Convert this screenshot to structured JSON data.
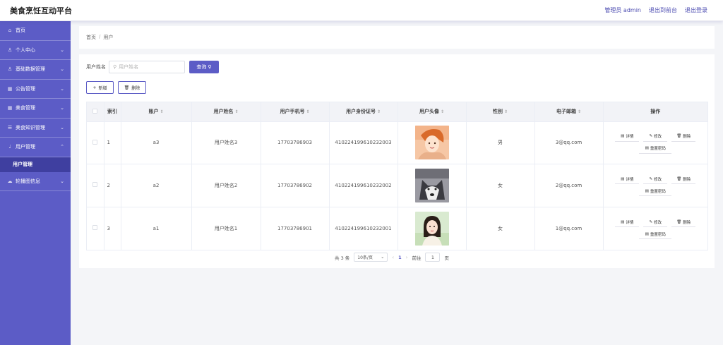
{
  "app": {
    "title": "美食烹饪互动平台"
  },
  "header": {
    "admin_label": "管理员 admin",
    "front_link": "退出到前台",
    "logout_link": "退出登录"
  },
  "sidebar": {
    "items": [
      {
        "label": "首页",
        "icon": "home-icon",
        "has_chevron": false
      },
      {
        "label": "个人中心",
        "icon": "person-icon",
        "has_chevron": true
      },
      {
        "label": "基础数据管理",
        "icon": "person-icon",
        "has_chevron": true
      },
      {
        "label": "公告管理",
        "icon": "grid-icon",
        "has_chevron": true
      },
      {
        "label": "美食管理",
        "icon": "grid-icon",
        "has_chevron": true
      },
      {
        "label": "美食知识管理",
        "icon": "list-icon",
        "has_chevron": true
      },
      {
        "label": "用户管理",
        "icon": "mic-icon",
        "has_chevron": true,
        "expanded": true
      },
      {
        "label": "轮播图信息",
        "icon": "cloud-icon",
        "has_chevron": true
      }
    ],
    "sub_item": "用户管理"
  },
  "breadcrumb": {
    "home": "首页",
    "separator": "/",
    "current": "用户"
  },
  "search": {
    "label": "用户姓名",
    "placeholder": "用户姓名",
    "value": "",
    "button": "查询"
  },
  "actions": {
    "add": "新增",
    "delete": "删除"
  },
  "table": {
    "columns": [
      "索引",
      "账户",
      "用户姓名",
      "用户手机号",
      "用户身份证号",
      "用户头像",
      "性别",
      "电子邮箱",
      "操作"
    ],
    "sortable": [
      false,
      true,
      true,
      true,
      true,
      true,
      true,
      true,
      false
    ],
    "rows": [
      {
        "index": "1",
        "account": "a3",
        "name": "用户姓名3",
        "phone": "17703786903",
        "idcard": "410224199610232003",
        "gender": "男",
        "email": "3@qq.com"
      },
      {
        "index": "2",
        "account": "a2",
        "name": "用户姓名2",
        "phone": "17703786902",
        "idcard": "410224199610232002",
        "gender": "女",
        "email": "2@qq.com"
      },
      {
        "index": "3",
        "account": "a1",
        "name": "用户姓名1",
        "phone": "17703786901",
        "idcard": "410224199610232001",
        "gender": "女",
        "email": "1@qq.com"
      }
    ],
    "row_actions": {
      "detail": "详情",
      "edit": "修改",
      "delete": "删除",
      "reset": "重置密码"
    }
  },
  "pagination": {
    "total": "共 3 条",
    "page_size": "10条/页",
    "current": "1",
    "goto_prefix": "前往",
    "goto_value": "1",
    "goto_suffix": "页"
  },
  "colors": {
    "primary": "#5c5cc6",
    "sidebar_active": "#3f3fa0",
    "background": "#f4f5f8"
  }
}
